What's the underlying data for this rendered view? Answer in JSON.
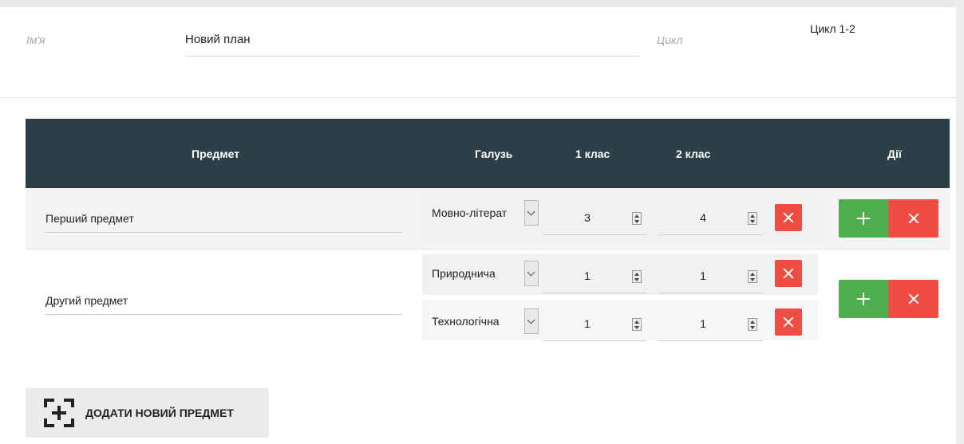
{
  "form": {
    "name_label": "Ім'я",
    "name_value": "Новий план",
    "cycle_label": "Цикл",
    "cycle_value": "Цикл 1-2"
  },
  "table": {
    "headers": {
      "subject": "Предмет",
      "domain": "Галузь",
      "grade1": "1 клас",
      "grade2": "2 клас",
      "actions": "Дії"
    },
    "rows": [
      {
        "subject": "Перший предмет",
        "lines": [
          {
            "domain": "Мовно-літерат",
            "grade1": "3",
            "grade2": "4"
          }
        ]
      },
      {
        "subject": "Другий предмет",
        "lines": [
          {
            "domain": "Природнича",
            "grade1": "1",
            "grade2": "1"
          },
          {
            "domain": "Технологічна",
            "grade1": "1",
            "grade2": "1"
          }
        ]
      }
    ]
  },
  "add_subject_button": "ДОДАТИ НОВИЙ ПРЕДМЕТ",
  "colors": {
    "header_bg": "#2c3e46",
    "add_green": "#4cae4c",
    "delete_red": "#ef4d43"
  },
  "icons": {
    "add": "plus-icon",
    "delete": "x-icon",
    "add_subject": "add-box-icon",
    "dropdown": "chevron-down-icon",
    "spinner": "spinner-icon"
  }
}
